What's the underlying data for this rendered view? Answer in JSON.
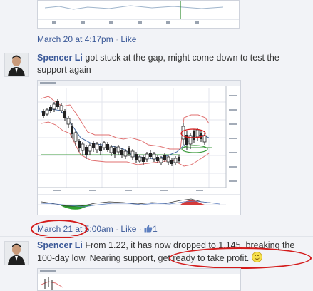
{
  "posts": [
    {
      "meta": {
        "time": "March 20 at 4:17pm",
        "like_label": "Like"
      }
    },
    {
      "author": "Spencer Li",
      "text": " got stuck at the gap, might come down to test the support again",
      "meta": {
        "time": "March 21 at 5:00am",
        "like_label": "Like",
        "like_count": "1"
      }
    },
    {
      "author": "Spencer Li",
      "text_before": " From 1.22, it has now dropped to 1.145, breaking the 100-day low. Nearing support, ",
      "text_highlight": "get ready to take profit.",
      "emoji": "smiley-emoji"
    }
  ],
  "colors": {
    "link": "#3b5998",
    "annotation": "#d41b1b",
    "meta": "#7f8aa6"
  },
  "icons": [
    "thumbs-up-icon",
    "smiley-emoji"
  ]
}
